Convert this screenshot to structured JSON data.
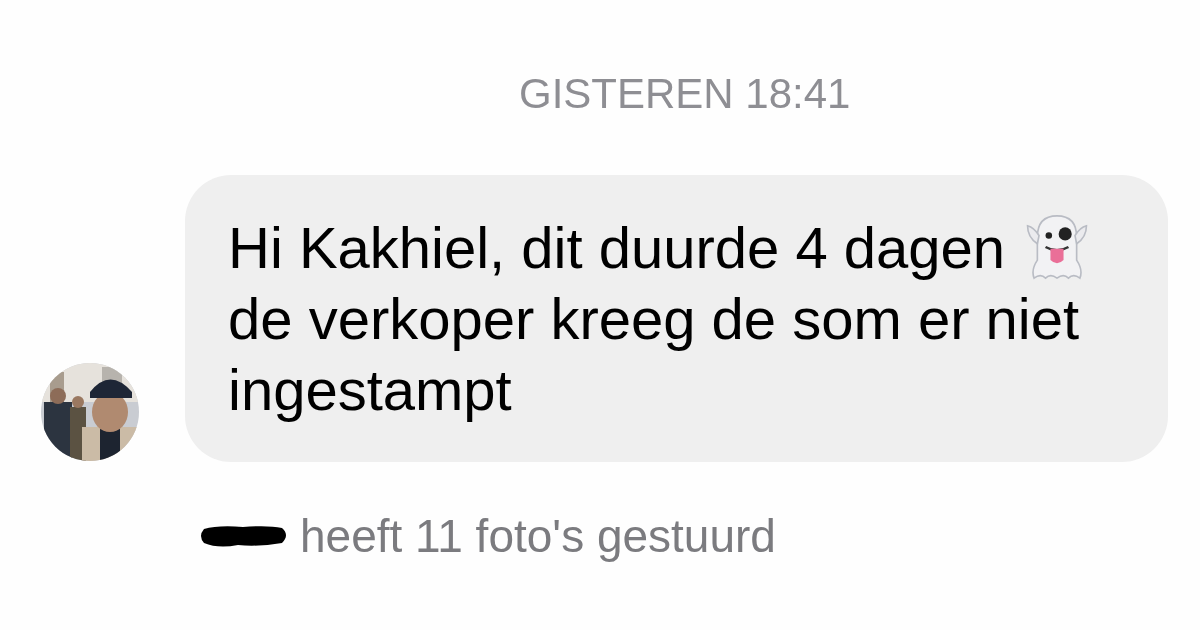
{
  "timestamp": "GISTEREN 18:41",
  "message": {
    "parts": [
      {
        "kind": "text",
        "text": "Hi Kakhiel, dit duurde 4 dagen"
      },
      {
        "kind": "emoji"
      },
      {
        "kind": "text",
        "text": "de verkoper kreeg de som er niet ingestampt"
      }
    ]
  },
  "notice": {
    "sender_redacted": true,
    "text": "heeft 11 foto's gestuurd"
  }
}
